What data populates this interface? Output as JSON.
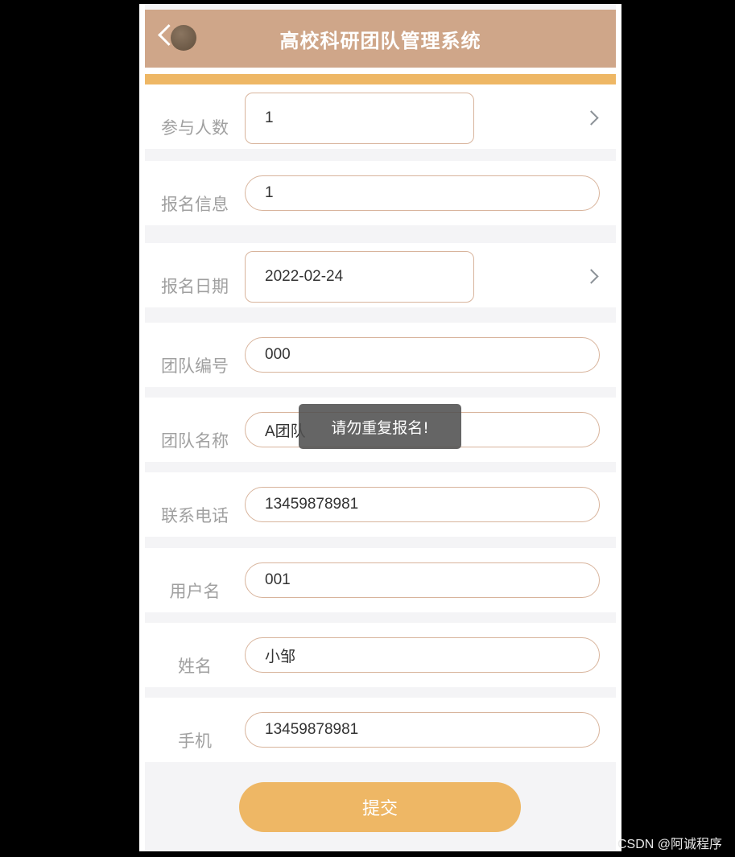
{
  "header": {
    "title": "高校科研团队管理系统"
  },
  "form": {
    "rows": [
      {
        "label": "参与人数",
        "value": "1",
        "type": "picker"
      },
      {
        "label": "报名信息",
        "value": "1",
        "type": "input"
      },
      {
        "label": "报名日期",
        "value": "2022-02-24",
        "type": "picker"
      },
      {
        "label": "团队编号",
        "value": "000",
        "type": "input"
      },
      {
        "label": "团队名称",
        "value": "A团队",
        "type": "input"
      },
      {
        "label": "联系电话",
        "value": "13459878981",
        "type": "input"
      },
      {
        "label": "用户名",
        "value": "001",
        "type": "input"
      },
      {
        "label": "姓名",
        "value": "小邹",
        "type": "input"
      },
      {
        "label": "手机",
        "value": "13459878981",
        "type": "input"
      }
    ]
  },
  "submit": {
    "label": "提交"
  },
  "toast": {
    "message": "请勿重复报名!"
  },
  "watermark": {
    "text": "CSDN @阿诚程序"
  },
  "colors": {
    "header": "#cfa689",
    "accent": "#eeb765",
    "field_border": "#d8b49c"
  }
}
